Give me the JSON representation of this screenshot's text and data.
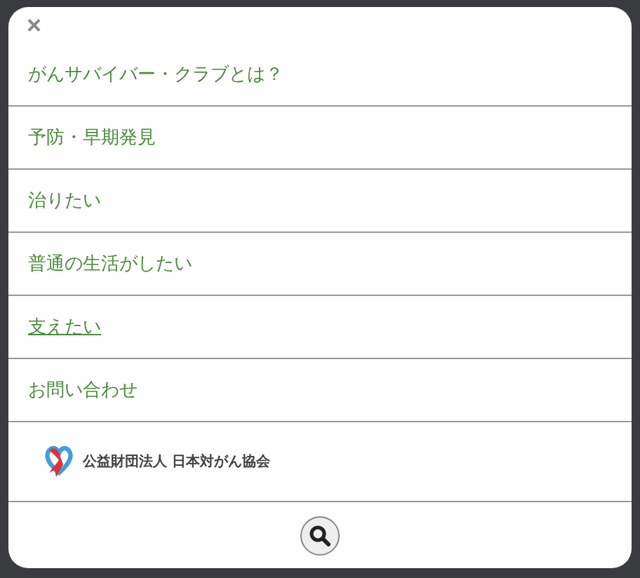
{
  "close_button": {
    "label": "×"
  },
  "menu_items": [
    {
      "label": "がんサバイバー・クラブとは？",
      "hovered": false
    },
    {
      "label": "予防・早期発見",
      "hovered": false
    },
    {
      "label": "治りたい",
      "hovered": false
    },
    {
      "label": "普通の生活がしたい",
      "hovered": false
    },
    {
      "label": "支えたい",
      "hovered": true
    },
    {
      "label": "お問い合わせ",
      "hovered": false
    }
  ],
  "organization": {
    "name": "公益財団法人 日本対がん協会"
  }
}
